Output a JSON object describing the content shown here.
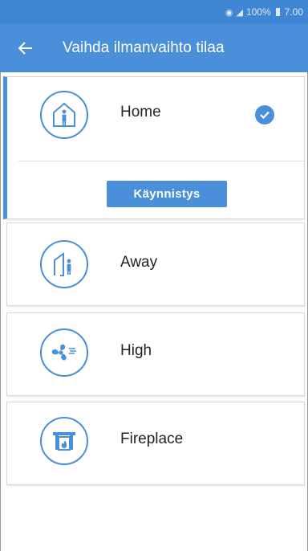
{
  "status_bar": {
    "battery": "100%",
    "time": "7.00"
  },
  "app_bar": {
    "title": "Vaihda ilmanvaihto tilaa"
  },
  "modes": [
    {
      "label": "Home",
      "icon": "home-person-icon",
      "selected": true,
      "action_label": "Käynnistys"
    },
    {
      "label": "Away",
      "icon": "away-person-icon",
      "selected": false
    },
    {
      "label": "High",
      "icon": "fan-icon",
      "selected": false
    },
    {
      "label": "Fireplace",
      "icon": "fireplace-icon",
      "selected": false
    }
  ],
  "colors": {
    "primary": "#4a8fd9",
    "status_bar": "#3f86d4",
    "text": "#222222"
  }
}
